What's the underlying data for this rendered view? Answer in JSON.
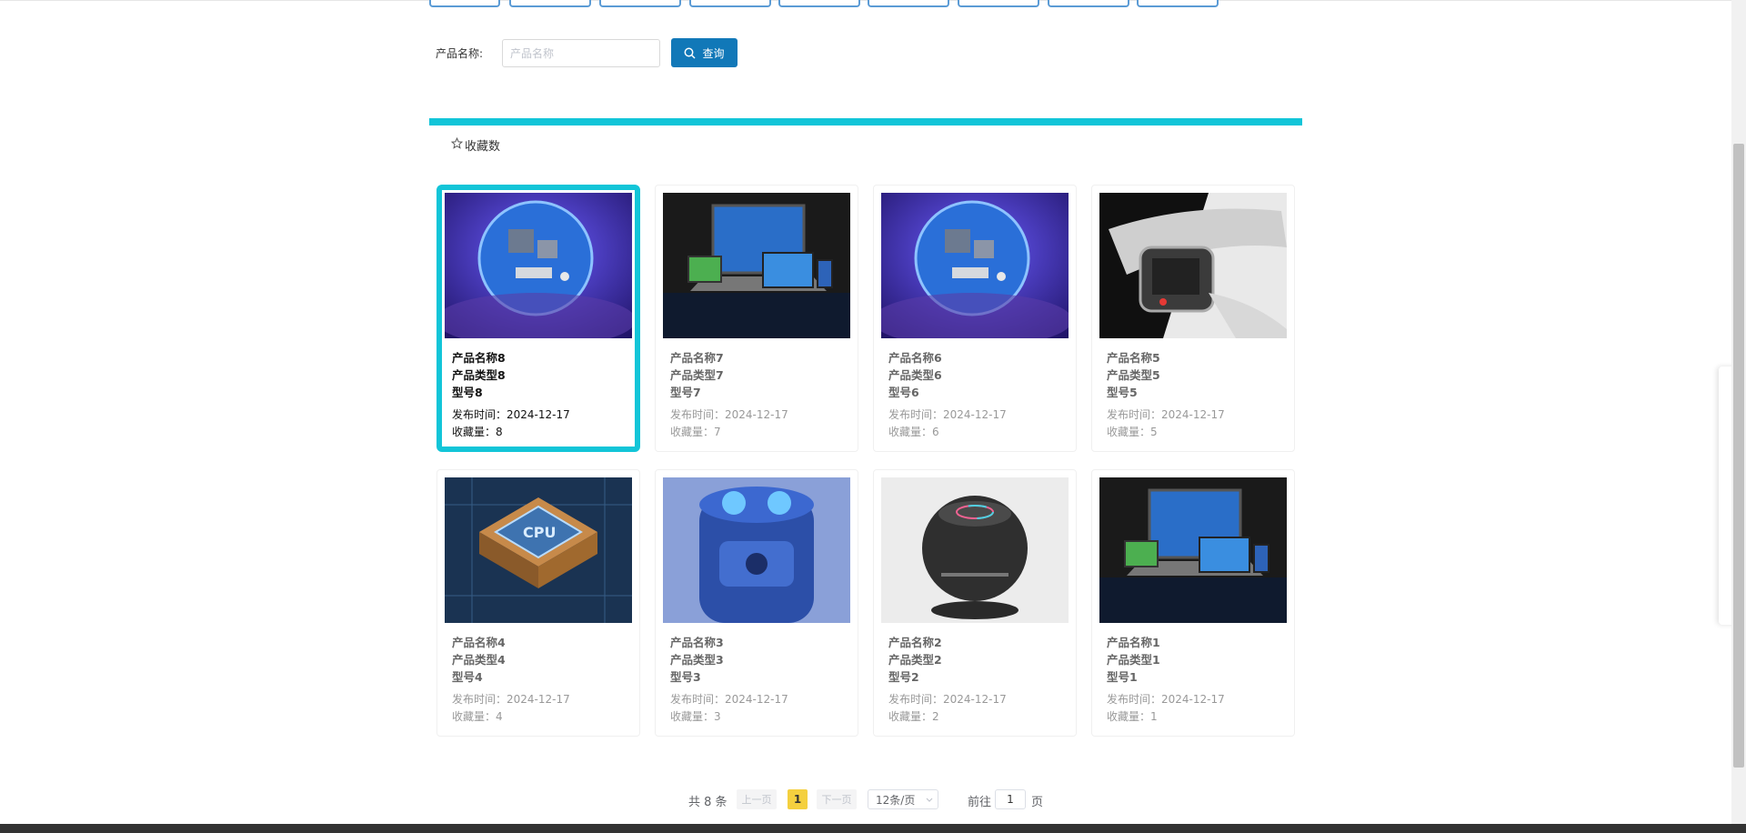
{
  "search": {
    "label": "产品名称:",
    "placeholder": "产品名称",
    "button_label": "查询"
  },
  "sort": {
    "label": "收藏数"
  },
  "products": [
    {
      "name": "产品名称8",
      "type": "产品类型8",
      "model": "型号8",
      "date": "发布时间：2024-12-17",
      "fav": "收藏量：8",
      "image": "circuit-board"
    },
    {
      "name": "产品名称7",
      "type": "产品类型7",
      "model": "型号7",
      "date": "发布时间：2024-12-17",
      "fav": "收藏量：7",
      "image": "devices"
    },
    {
      "name": "产品名称6",
      "type": "产品类型6",
      "model": "型号6",
      "date": "发布时间：2024-12-17",
      "fav": "收藏量：6",
      "image": "circuit-board"
    },
    {
      "name": "产品名称5",
      "type": "产品类型5",
      "model": "型号5",
      "date": "发布时间：2024-12-17",
      "fav": "收藏量：5",
      "image": "smartwatch"
    },
    {
      "name": "产品名称4",
      "type": "产品类型4",
      "model": "型号4",
      "date": "发布时间：2024-12-17",
      "fav": "收藏量：4",
      "image": "cpu"
    },
    {
      "name": "产品名称3",
      "type": "产品类型3",
      "model": "型号3",
      "date": "发布时间：2024-12-17",
      "fav": "收藏量：3",
      "image": "purifier"
    },
    {
      "name": "产品名称2",
      "type": "产品类型2",
      "model": "型号2",
      "date": "发布时间：2024-12-17",
      "fav": "收藏量：2",
      "image": "speaker"
    },
    {
      "name": "产品名称1",
      "type": "产品类型1",
      "model": "型号1",
      "date": "发布时间：2024-12-17",
      "fav": "收藏量：1",
      "image": "devices"
    }
  ],
  "pagination": {
    "total": "共 8 条",
    "prev": "上一页",
    "current_page": "1",
    "next": "下一页",
    "page_size": "12条/页",
    "goto_label": "前往",
    "goto_value": "1",
    "goto_unit": "页"
  },
  "colors": {
    "accent": "#12c5d8",
    "primary_button": "#1178b8",
    "current_page": "#f4d03f"
  }
}
